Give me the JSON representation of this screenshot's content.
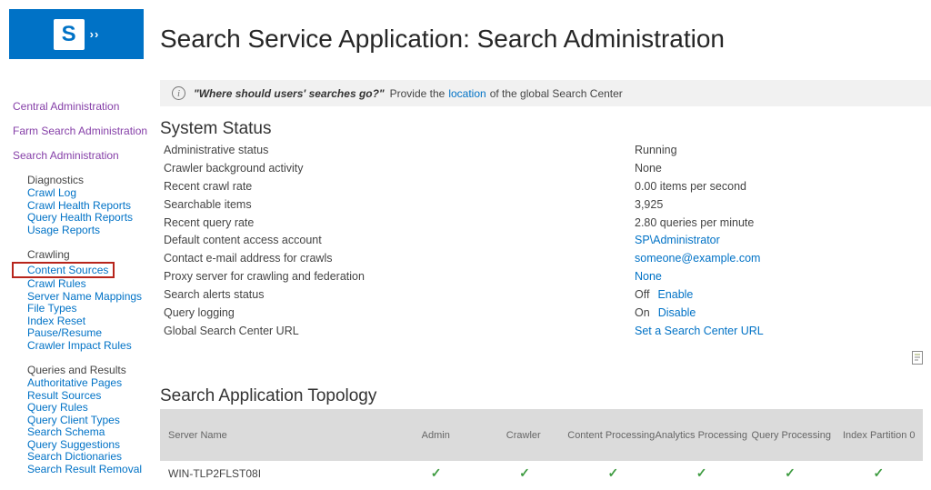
{
  "app": {
    "logo_letter": "S",
    "logo_arrows": "››",
    "title": "Search Service Application: Search Administration"
  },
  "colors": {
    "brand_blue": "#0072C6",
    "link_blue": "#0072C6",
    "visited_purple": "#8640A8",
    "check_green": "#3F9C42",
    "highlight_red": "#B7251C",
    "notice_bg": "#F1F1F1",
    "table_header_bg": "#DBDBDB"
  },
  "notice": {
    "question": "\"Where should users' searches go?\"",
    "pre": "Provide the",
    "link": "location",
    "post": "of the global Search Center"
  },
  "sidebar": {
    "top_links": [
      "Central Administration",
      "Farm Search Administration",
      "Search Administration"
    ],
    "sections": [
      {
        "label": "Diagnostics",
        "items": [
          "Crawl Log",
          "Crawl Health Reports",
          "Query Health Reports",
          "Usage Reports"
        ]
      },
      {
        "label": "Crawling",
        "items": [
          "Content Sources",
          "Crawl Rules",
          "Server Name Mappings",
          "File Types",
          "Index Reset",
          "Pause/Resume",
          "Crawler Impact Rules"
        ]
      },
      {
        "label": "Queries and Results",
        "items": [
          "Authoritative Pages",
          "Result Sources",
          "Query Rules",
          "Query Client Types",
          "Search Schema",
          "Query Suggestions",
          "Search Dictionaries",
          "Search Result Removal"
        ]
      }
    ],
    "highlighted_item": "Content Sources"
  },
  "system_status": {
    "heading": "System Status",
    "rows": [
      {
        "label": "Administrative status",
        "value": "Running"
      },
      {
        "label": "Crawler background activity",
        "value": "None"
      },
      {
        "label": "Recent crawl rate",
        "value": "0.00 items per second"
      },
      {
        "label": "Searchable items",
        "value": "3,925"
      },
      {
        "label": "Recent query rate",
        "value": "2.80 queries per minute"
      },
      {
        "label": "Default content access account",
        "value": "SP\\Administrator"
      },
      {
        "label": "Contact e-mail address for crawls",
        "value": "someone@example.com"
      },
      {
        "label": "Proxy server for crawling and federation",
        "value": "None"
      },
      {
        "label": "Search alerts status",
        "value": "Off",
        "action": "Enable"
      },
      {
        "label": "Query logging",
        "value": "On",
        "action": "Disable"
      },
      {
        "label": "Global Search Center URL",
        "value": "Set a Search Center URL"
      }
    ]
  },
  "topology": {
    "heading": "Search Application Topology",
    "columns": [
      "Server Name",
      "Admin",
      "Crawler",
      "Content Processing",
      "Analytics Processing",
      "Query Processing",
      "Index Partition 0"
    ],
    "check_glyph": "✓",
    "rows": [
      {
        "server": "WIN-TLP2FLST08I"
      }
    ]
  }
}
